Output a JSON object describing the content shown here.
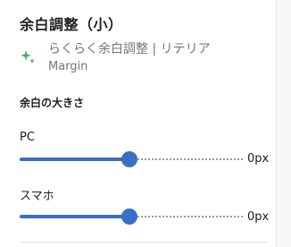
{
  "panel": {
    "title": "余白調整（小）",
    "block": {
      "icon": "sparkle-icon",
      "icon_color": "#3ab55a",
      "title": "らくらく余白調整 | リテリア",
      "subtitle": "Margin"
    },
    "section_title": "余白の大きさ",
    "controls": [
      {
        "label": "PC",
        "value_text": "0px",
        "level": 0.49
      },
      {
        "label": "スマホ",
        "value_text": "0px",
        "level": 0.49
      }
    ]
  },
  "colors": {
    "accent": "#3a6fc6"
  }
}
